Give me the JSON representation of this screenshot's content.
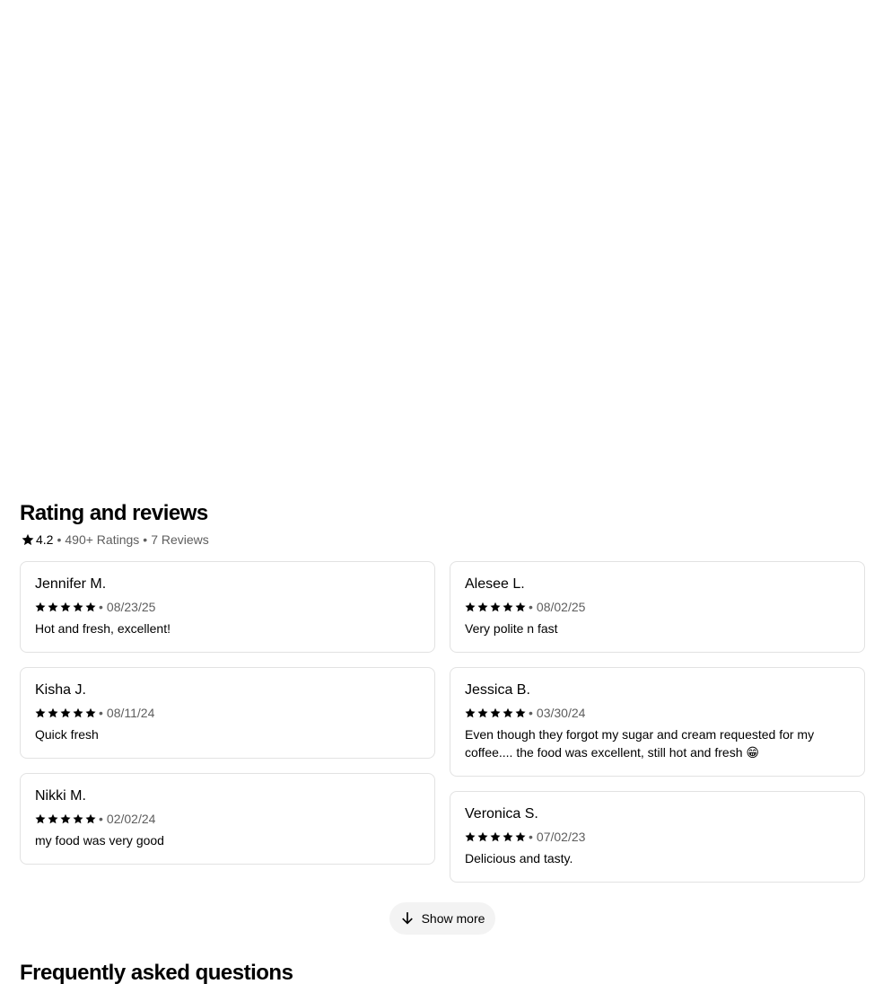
{
  "reviews_section": {
    "title": "Rating and reviews",
    "rating": "4.2",
    "ratings_count": "490+ Ratings",
    "reviews_count": "7 Reviews",
    "separator": "•"
  },
  "reviews_left": [
    {
      "name": "Jennifer M.",
      "stars": 5,
      "date": "08/23/25",
      "text": "Hot and fresh, excellent!"
    },
    {
      "name": "Kisha J.",
      "stars": 5,
      "date": "08/11/24",
      "text": "Quick fresh"
    },
    {
      "name": "Nikki M.",
      "stars": 5,
      "date": "02/02/24",
      "text": "my food was very good"
    }
  ],
  "reviews_right": [
    {
      "name": "Alesee L.",
      "stars": 5,
      "date": "08/02/25",
      "text": "Very polite n fast"
    },
    {
      "name": "Jessica B.",
      "stars": 5,
      "date": "03/30/24",
      "text": "Even though they forgot my sugar and cream requested for my coffee.... the food was excellent, still hot and fresh 😁"
    },
    {
      "name": "Veronica S.",
      "stars": 5,
      "date": "07/02/23",
      "text": "Delicious and tasty."
    }
  ],
  "show_more": {
    "label": "Show more",
    "icon": "arrow-down-icon"
  },
  "faq": {
    "title": "Frequently asked questions"
  },
  "colors": {
    "text": "#000000",
    "muted": "#5e5e5e",
    "border": "#e2e2e2",
    "button_bg": "#f3f3f3"
  }
}
